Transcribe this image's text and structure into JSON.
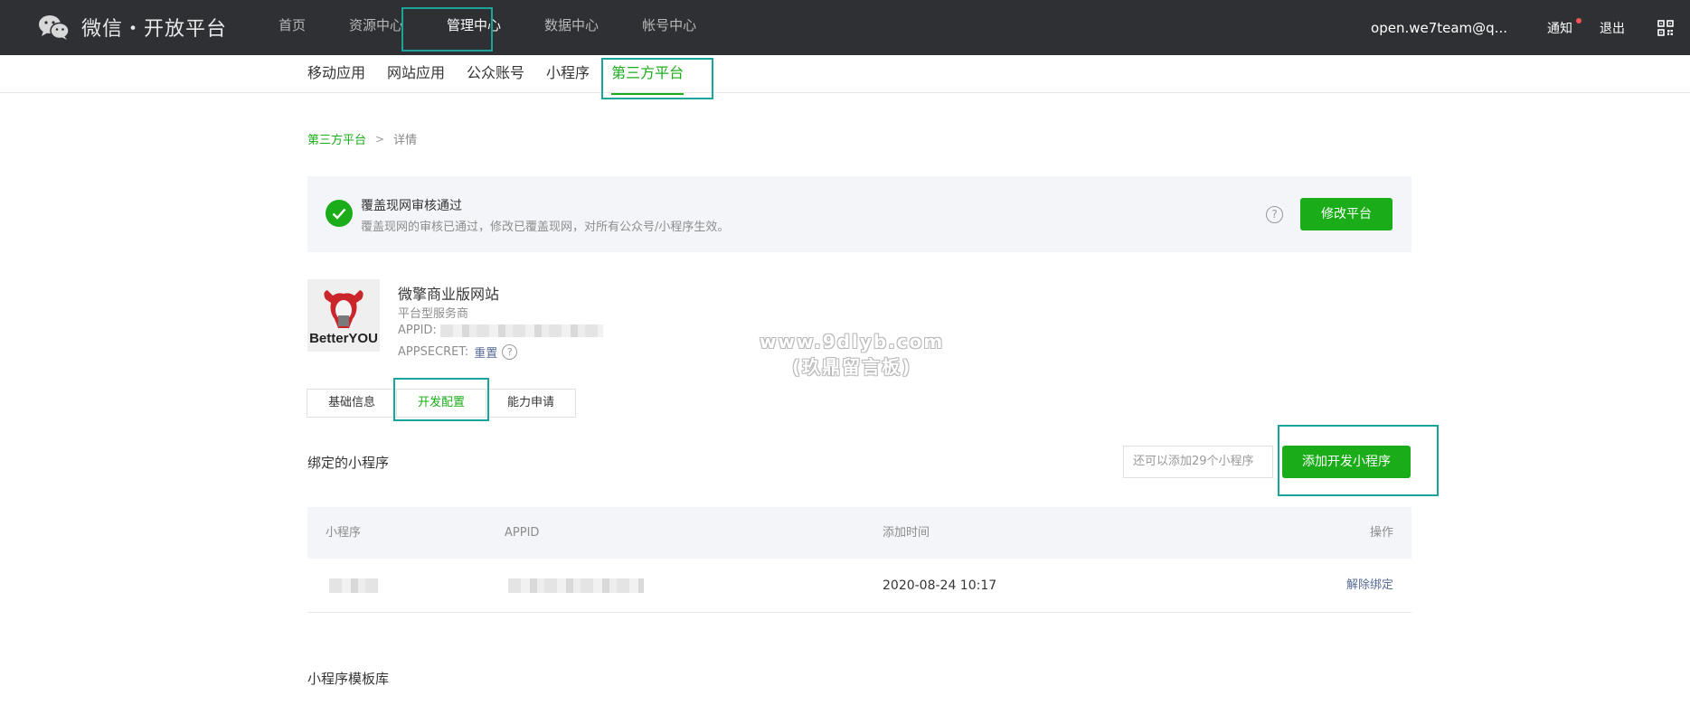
{
  "header": {
    "logo_text": "微信・开放平台",
    "nav": [
      {
        "label": "首页"
      },
      {
        "label": "资源中心"
      },
      {
        "label": "管理中心"
      },
      {
        "label": "数据中心"
      },
      {
        "label": "帐号中心"
      }
    ],
    "active_nav": "管理中心",
    "account": "open.we7team@q...",
    "notify_label": "通知",
    "logout_label": "退出"
  },
  "subnav": {
    "items": [
      {
        "label": "移动应用"
      },
      {
        "label": "网站应用"
      },
      {
        "label": "公众账号"
      },
      {
        "label": "小程序"
      },
      {
        "label": "第三方平台"
      }
    ],
    "active": "第三方平台"
  },
  "breadcrumb": {
    "parent": "第三方平台",
    "separator": ">",
    "current": "详情"
  },
  "status": {
    "title": "覆盖现网审核通过",
    "description": "覆盖现网的审核已通过，修改已覆盖现网，对所有公众号/小程序生效。",
    "help": "?",
    "edit_button": "修改平台"
  },
  "platform": {
    "logo_text": "BetterYOU",
    "name": "微擎商业版网站",
    "type": "平台型服务商",
    "appid_label": "APPID:",
    "secret_label": "APPSECRET:",
    "reset_label": "重置",
    "help": "?"
  },
  "watermark": {
    "line1": "www.9dlyb.com",
    "line2": "(玖鼎留言板)"
  },
  "tabs": [
    {
      "label": "基础信息"
    },
    {
      "label": "开发配置"
    },
    {
      "label": "能力申请"
    }
  ],
  "active_tab": "开发配置",
  "bound": {
    "title": "绑定的小程序",
    "quota_placeholder": "还可以添加29个小程序",
    "add_button": "添加开发小程序",
    "columns": [
      "小程序",
      "APPID",
      "添加时间",
      "操作"
    ],
    "rows": [
      {
        "added_time": "2020-08-24 10:17",
        "action": "解除绑定"
      }
    ]
  },
  "templates_title": "小程序模板库",
  "colors": {
    "brand_green": "#1aad19",
    "topbar_bg": "#2e3033",
    "highlight": "#1aa59a",
    "link_blue": "#576b95"
  }
}
